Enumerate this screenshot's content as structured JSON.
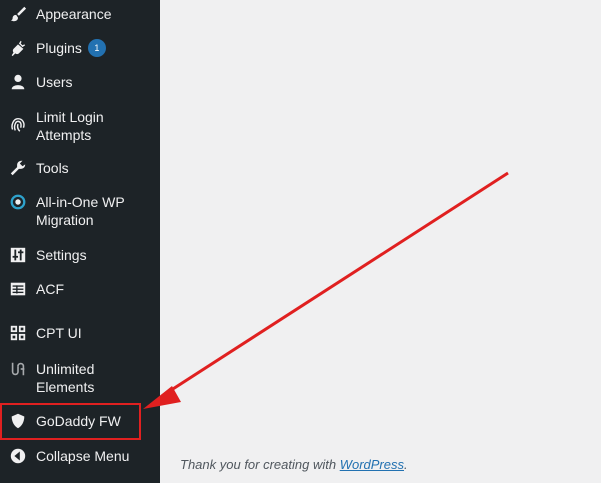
{
  "sidebar": {
    "items": [
      {
        "label": "Appearance",
        "icon": "paintbrush-icon"
      },
      {
        "label": "Plugins",
        "icon": "plug-icon",
        "badge": "1"
      },
      {
        "label": "Users",
        "icon": "user-icon"
      },
      {
        "label": "Limit Login Attempts",
        "icon": "fingerprint-icon"
      },
      {
        "label": "Tools",
        "icon": "wrench-icon"
      },
      {
        "label": "All-in-One WP Migration",
        "icon": "migration-icon"
      },
      {
        "label": "Settings",
        "icon": "sliders-icon"
      },
      {
        "label": "ACF",
        "icon": "table-icon"
      },
      {
        "label": "CPT UI",
        "icon": "grid-icon"
      },
      {
        "label": "Unlimited Elements",
        "icon": "unlimited-elements-icon"
      },
      {
        "label": "GoDaddy FW",
        "icon": "shield-icon"
      },
      {
        "label": "Collapse Menu",
        "icon": "collapse-left-icon"
      }
    ]
  },
  "footer": {
    "text_before": "Thank you for creating with ",
    "link": "WordPress",
    "text_after": "."
  },
  "colors": {
    "sidebar_bg": "#1d2327",
    "content_bg": "#f0f0f1",
    "badge": "#2271b1",
    "annotation": "#e02020"
  }
}
